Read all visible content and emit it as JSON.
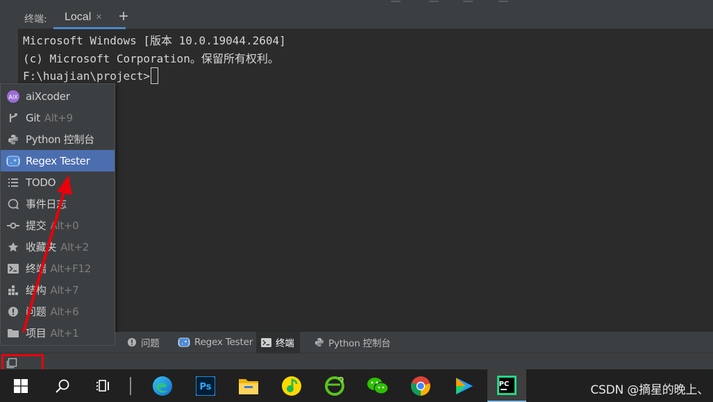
{
  "terminal_tabs": {
    "label": "终端:",
    "active_tab": "Local",
    "close_glyph": "×",
    "add_glyph": "+"
  },
  "terminal": {
    "lines": [
      "Microsoft Windows [版本 10.0.19044.2604]",
      "(c) Microsoft Corporation。保留所有权利。",
      "F:\\huajian\\project>"
    ]
  },
  "tool_menu": {
    "items": [
      {
        "label": "aiXcoder",
        "shortcut": "",
        "icon": "aixcoder-icon"
      },
      {
        "label": "Git",
        "shortcut": "Alt+9",
        "icon": "git-branch-icon"
      },
      {
        "label": "Python 控制台",
        "shortcut": "",
        "icon": "python-icon"
      },
      {
        "label": "Regex Tester",
        "shortcut": "",
        "icon": "regex-icon",
        "selected": true
      },
      {
        "label": "TODO",
        "shortcut": "",
        "icon": "list-icon"
      },
      {
        "label": "事件日志",
        "shortcut": "",
        "icon": "speech-bubble-icon"
      },
      {
        "label": "提交",
        "shortcut": "Alt+0",
        "icon": "commit-icon"
      },
      {
        "label": "收藏夹",
        "shortcut": "Alt+2",
        "icon": "star-icon"
      },
      {
        "label": "终端",
        "shortcut": "Alt+F12",
        "icon": "terminal-icon"
      },
      {
        "label": "结构",
        "shortcut": "Alt+7",
        "icon": "structure-icon"
      },
      {
        "label": "问题",
        "shortcut": "Alt+6",
        "icon": "problems-icon"
      },
      {
        "label": "项目",
        "shortcut": "Alt+1",
        "icon": "folder-icon"
      }
    ]
  },
  "tool_windows": {
    "tabs": [
      {
        "label": "问题",
        "icon": "problems-icon"
      },
      {
        "label": "Regex Tester",
        "icon": "regex-icon"
      },
      {
        "label": "终端",
        "icon": "terminal-icon",
        "active": true
      },
      {
        "label": "Python 控制台",
        "icon": "python-icon"
      }
    ]
  },
  "taskbar": {
    "apps": [
      {
        "name": "Start",
        "icon": "windows-start-icon"
      },
      {
        "name": "Search",
        "icon": "search-icon"
      },
      {
        "name": "Task View",
        "icon": "task-view-icon"
      },
      {
        "name": "Edge",
        "icon": "edge-icon"
      },
      {
        "name": "Photoshop",
        "icon": "photoshop-icon"
      },
      {
        "name": "File Explorer",
        "icon": "folder-icon"
      },
      {
        "name": "QQ Music",
        "icon": "music-icon"
      },
      {
        "name": "Browser",
        "icon": "browser-e-icon"
      },
      {
        "name": "WeChat",
        "icon": "wechat-icon"
      },
      {
        "name": "Chrome",
        "icon": "chrome-icon"
      },
      {
        "name": "Video Player",
        "icon": "video-play-icon"
      },
      {
        "name": "PyCharm",
        "icon": "pycharm-icon",
        "active": true
      }
    ],
    "watermark": "CSDN @摘星的晚上、"
  },
  "colors": {
    "accent": "#4b6eaf",
    "annotation": "#e8000c",
    "editor_bg": "#2b2b2b",
    "panel_bg": "#3c3f41"
  }
}
